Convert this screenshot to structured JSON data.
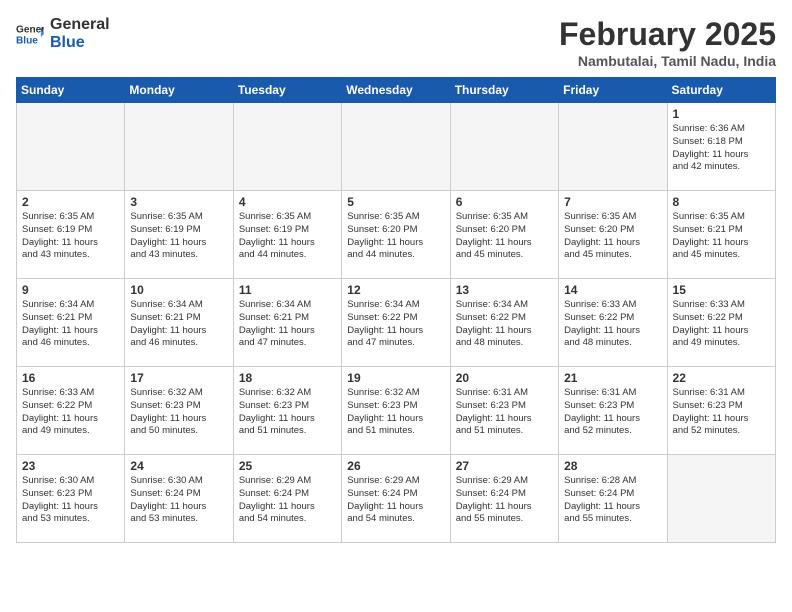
{
  "header": {
    "logo_general": "General",
    "logo_blue": "Blue",
    "month_title": "February 2025",
    "location": "Nambutalai, Tamil Nadu, India"
  },
  "days_of_week": [
    "Sunday",
    "Monday",
    "Tuesday",
    "Wednesday",
    "Thursday",
    "Friday",
    "Saturday"
  ],
  "weeks": [
    [
      {
        "day": "",
        "info": ""
      },
      {
        "day": "",
        "info": ""
      },
      {
        "day": "",
        "info": ""
      },
      {
        "day": "",
        "info": ""
      },
      {
        "day": "",
        "info": ""
      },
      {
        "day": "",
        "info": ""
      },
      {
        "day": "1",
        "info": "Sunrise: 6:36 AM\nSunset: 6:18 PM\nDaylight: 11 hours\nand 42 minutes."
      }
    ],
    [
      {
        "day": "2",
        "info": "Sunrise: 6:35 AM\nSunset: 6:19 PM\nDaylight: 11 hours\nand 43 minutes."
      },
      {
        "day": "3",
        "info": "Sunrise: 6:35 AM\nSunset: 6:19 PM\nDaylight: 11 hours\nand 43 minutes."
      },
      {
        "day": "4",
        "info": "Sunrise: 6:35 AM\nSunset: 6:19 PM\nDaylight: 11 hours\nand 44 minutes."
      },
      {
        "day": "5",
        "info": "Sunrise: 6:35 AM\nSunset: 6:20 PM\nDaylight: 11 hours\nand 44 minutes."
      },
      {
        "day": "6",
        "info": "Sunrise: 6:35 AM\nSunset: 6:20 PM\nDaylight: 11 hours\nand 45 minutes."
      },
      {
        "day": "7",
        "info": "Sunrise: 6:35 AM\nSunset: 6:20 PM\nDaylight: 11 hours\nand 45 minutes."
      },
      {
        "day": "8",
        "info": "Sunrise: 6:35 AM\nSunset: 6:21 PM\nDaylight: 11 hours\nand 45 minutes."
      }
    ],
    [
      {
        "day": "9",
        "info": "Sunrise: 6:34 AM\nSunset: 6:21 PM\nDaylight: 11 hours\nand 46 minutes."
      },
      {
        "day": "10",
        "info": "Sunrise: 6:34 AM\nSunset: 6:21 PM\nDaylight: 11 hours\nand 46 minutes."
      },
      {
        "day": "11",
        "info": "Sunrise: 6:34 AM\nSunset: 6:21 PM\nDaylight: 11 hours\nand 47 minutes."
      },
      {
        "day": "12",
        "info": "Sunrise: 6:34 AM\nSunset: 6:22 PM\nDaylight: 11 hours\nand 47 minutes."
      },
      {
        "day": "13",
        "info": "Sunrise: 6:34 AM\nSunset: 6:22 PM\nDaylight: 11 hours\nand 48 minutes."
      },
      {
        "day": "14",
        "info": "Sunrise: 6:33 AM\nSunset: 6:22 PM\nDaylight: 11 hours\nand 48 minutes."
      },
      {
        "day": "15",
        "info": "Sunrise: 6:33 AM\nSunset: 6:22 PM\nDaylight: 11 hours\nand 49 minutes."
      }
    ],
    [
      {
        "day": "16",
        "info": "Sunrise: 6:33 AM\nSunset: 6:22 PM\nDaylight: 11 hours\nand 49 minutes."
      },
      {
        "day": "17",
        "info": "Sunrise: 6:32 AM\nSunset: 6:23 PM\nDaylight: 11 hours\nand 50 minutes."
      },
      {
        "day": "18",
        "info": "Sunrise: 6:32 AM\nSunset: 6:23 PM\nDaylight: 11 hours\nand 51 minutes."
      },
      {
        "day": "19",
        "info": "Sunrise: 6:32 AM\nSunset: 6:23 PM\nDaylight: 11 hours\nand 51 minutes."
      },
      {
        "day": "20",
        "info": "Sunrise: 6:31 AM\nSunset: 6:23 PM\nDaylight: 11 hours\nand 51 minutes."
      },
      {
        "day": "21",
        "info": "Sunrise: 6:31 AM\nSunset: 6:23 PM\nDaylight: 11 hours\nand 52 minutes."
      },
      {
        "day": "22",
        "info": "Sunrise: 6:31 AM\nSunset: 6:23 PM\nDaylight: 11 hours\nand 52 minutes."
      }
    ],
    [
      {
        "day": "23",
        "info": "Sunrise: 6:30 AM\nSunset: 6:23 PM\nDaylight: 11 hours\nand 53 minutes."
      },
      {
        "day": "24",
        "info": "Sunrise: 6:30 AM\nSunset: 6:24 PM\nDaylight: 11 hours\nand 53 minutes."
      },
      {
        "day": "25",
        "info": "Sunrise: 6:29 AM\nSunset: 6:24 PM\nDaylight: 11 hours\nand 54 minutes."
      },
      {
        "day": "26",
        "info": "Sunrise: 6:29 AM\nSunset: 6:24 PM\nDaylight: 11 hours\nand 54 minutes."
      },
      {
        "day": "27",
        "info": "Sunrise: 6:29 AM\nSunset: 6:24 PM\nDaylight: 11 hours\nand 55 minutes."
      },
      {
        "day": "28",
        "info": "Sunrise: 6:28 AM\nSunset: 6:24 PM\nDaylight: 11 hours\nand 55 minutes."
      },
      {
        "day": "",
        "info": ""
      }
    ]
  ]
}
